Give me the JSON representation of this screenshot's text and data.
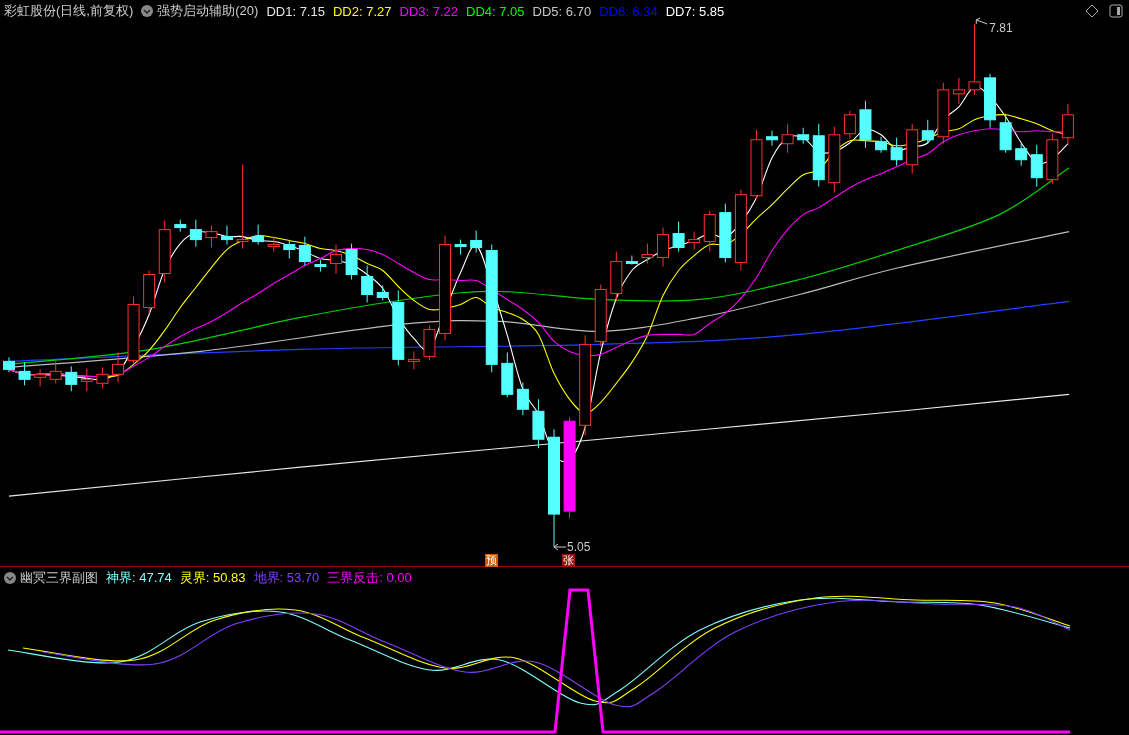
{
  "main_panel": {
    "title": "彩虹股份(日线,前复权)",
    "indicator": "强势启动辅助(20)",
    "values": [
      {
        "label": "DD1:",
        "value": "7.15",
        "color": "#e6e6e6"
      },
      {
        "label": "DD2:",
        "value": "7.27",
        "color": "#ffff00"
      },
      {
        "label": "DD3:",
        "value": "7.22",
        "color": "#ff00ff"
      },
      {
        "label": "DD4:",
        "value": "7.05",
        "color": "#00ff00"
      },
      {
        "label": "DD5:",
        "value": "6.70",
        "color": "#c8c8c8"
      },
      {
        "label": "DD6:",
        "value": "6.34",
        "color": "#0000ff"
      },
      {
        "label": "DD7:",
        "value": "5.85",
        "color": "#ffffff"
      }
    ],
    "high_label": "7.81",
    "low_label": "5.05",
    "signals": [
      {
        "text": "预",
        "color": "#c85a00"
      },
      {
        "text": "张",
        "color": "#a01010"
      }
    ]
  },
  "sub_panel": {
    "title": "幽冥三界副图",
    "values": [
      {
        "label": "神界:",
        "value": "47.74",
        "color": "#80ffff"
      },
      {
        "label": "灵界:",
        "value": "50.83",
        "color": "#ffff00"
      },
      {
        "label": "地界:",
        "value": "53.70",
        "color": "#8040ff"
      },
      {
        "label": "三界反击:",
        "value": "0.00",
        "color": "#ff00ff"
      }
    ]
  }
}
